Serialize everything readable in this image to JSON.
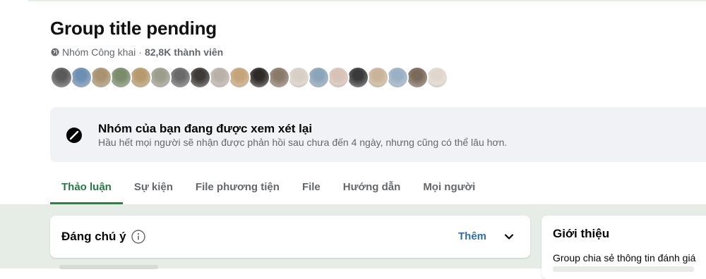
{
  "group": {
    "title": "Group title pending",
    "privacy": "Nhóm Công khai",
    "separator": "·",
    "members": "82,8K thành viên"
  },
  "avatars": [
    {
      "color": "#5a5a5a"
    },
    {
      "color": "#6d8fb1"
    },
    {
      "color": "#a89270"
    },
    {
      "color": "#7a8c6a"
    },
    {
      "color": "#b59a6e"
    },
    {
      "color": "#9d9d8c"
    },
    {
      "color": "#6a6a6a"
    },
    {
      "color": "#3e3a38"
    },
    {
      "color": "#b9b0a8"
    },
    {
      "color": "#c4a47a"
    },
    {
      "color": "#2e2a28"
    },
    {
      "color": "#8a7a6a"
    },
    {
      "color": "#d8cfc6"
    },
    {
      "color": "#8aa4b8"
    },
    {
      "color": "#d6c2b6"
    },
    {
      "color": "#3a3a3a"
    },
    {
      "color": "#c9b49a"
    },
    {
      "color": "#9ab0c4"
    },
    {
      "color": "#7a6a5a"
    },
    {
      "color": "#e0d6cc"
    }
  ],
  "notice": {
    "icon": "disabled-icon",
    "heading": "Nhóm của bạn đang được xem xét lại",
    "subtext": "Hầu hết mọi người sẽ nhận được phản hồi sau chưa đến 4 ngày, nhưng cũng có thể lâu hơn."
  },
  "tabs": [
    {
      "label": "Thảo luận",
      "active": true
    },
    {
      "label": "Sự kiện"
    },
    {
      "label": "File phương tiện"
    },
    {
      "label": "File"
    },
    {
      "label": "Hướng dẫn"
    },
    {
      "label": "Mọi người"
    }
  ],
  "featured": {
    "label": "Đáng chú ý",
    "more_label": "Thêm"
  },
  "about": {
    "heading": "Giới thiệu",
    "text": "Group chia sẻ thông tin đánh giá"
  },
  "colors": {
    "accent_green": "#1d8a3e",
    "link_blue": "#2d6fb0",
    "page_bg_lower": "#e6ede6"
  }
}
